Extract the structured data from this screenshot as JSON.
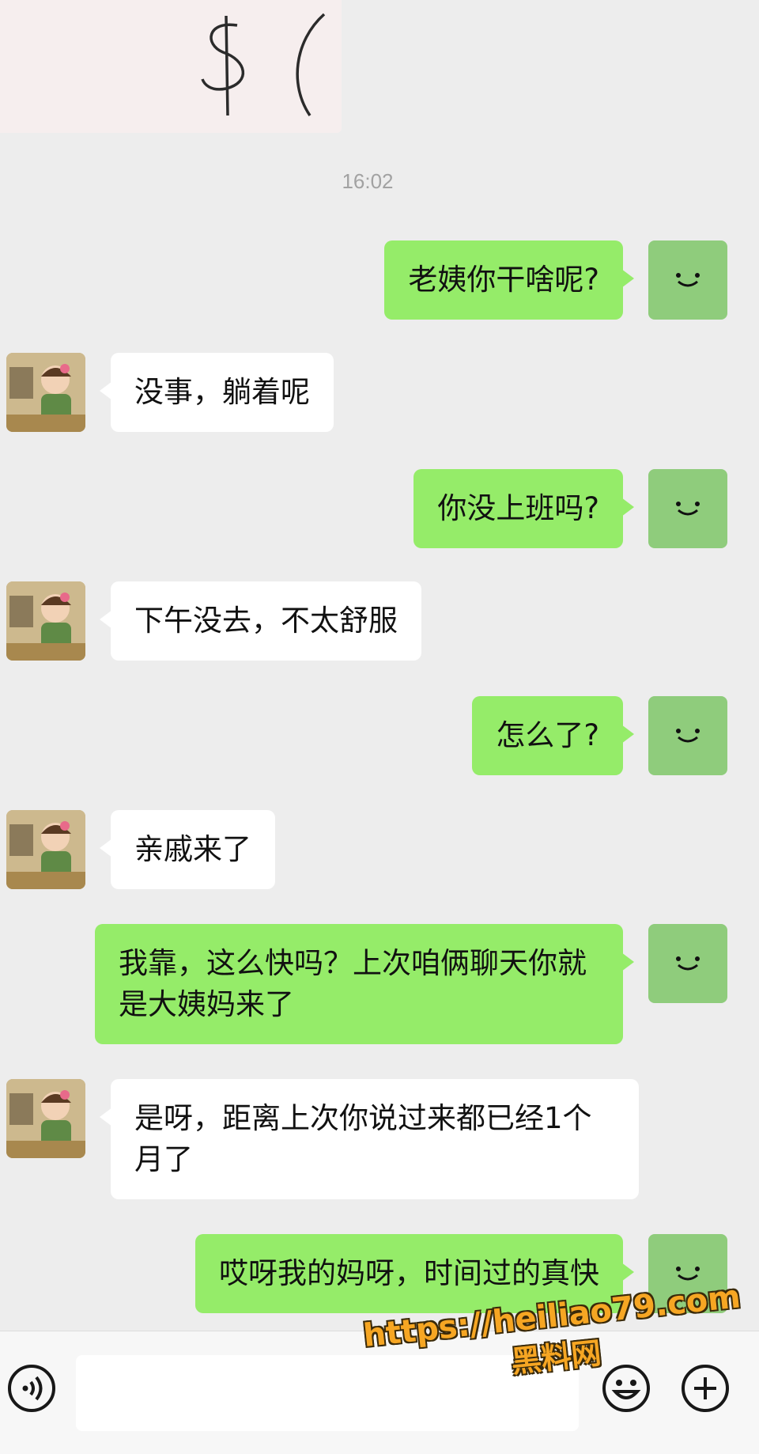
{
  "top_image": {
    "icon": "handwritten-dollar-sketch"
  },
  "timestamp": "16:02",
  "messages": [
    {
      "sender": "self",
      "text": "老姨你干啥呢?"
    },
    {
      "sender": "other",
      "text": "没事，躺着呢"
    },
    {
      "sender": "self",
      "text": "你没上班吗?"
    },
    {
      "sender": "other",
      "text": "下午没去，不太舒服"
    },
    {
      "sender": "self",
      "text": "怎么了?"
    },
    {
      "sender": "other",
      "text": "亲戚来了"
    },
    {
      "sender": "self",
      "text": "我靠，这么快吗？上次咱俩聊天你就是大姨妈来了"
    },
    {
      "sender": "other",
      "text": "是呀，距离上次你说过来都已经1个月了"
    },
    {
      "sender": "self",
      "text": "哎呀我的妈呀，时间过的真快"
    }
  ],
  "bottom_bar": {
    "voice_icon": "voice-icon",
    "emoji_icon": "emoji-icon",
    "plus_icon": "plus-icon",
    "input_value": ""
  },
  "watermark": {
    "url": "https://heiliao79.com",
    "name": "黑料网"
  },
  "colors": {
    "self_bubble": "#95ec69",
    "other_bubble": "#ffffff",
    "background": "#ededed",
    "watermark": "#f6a623"
  }
}
